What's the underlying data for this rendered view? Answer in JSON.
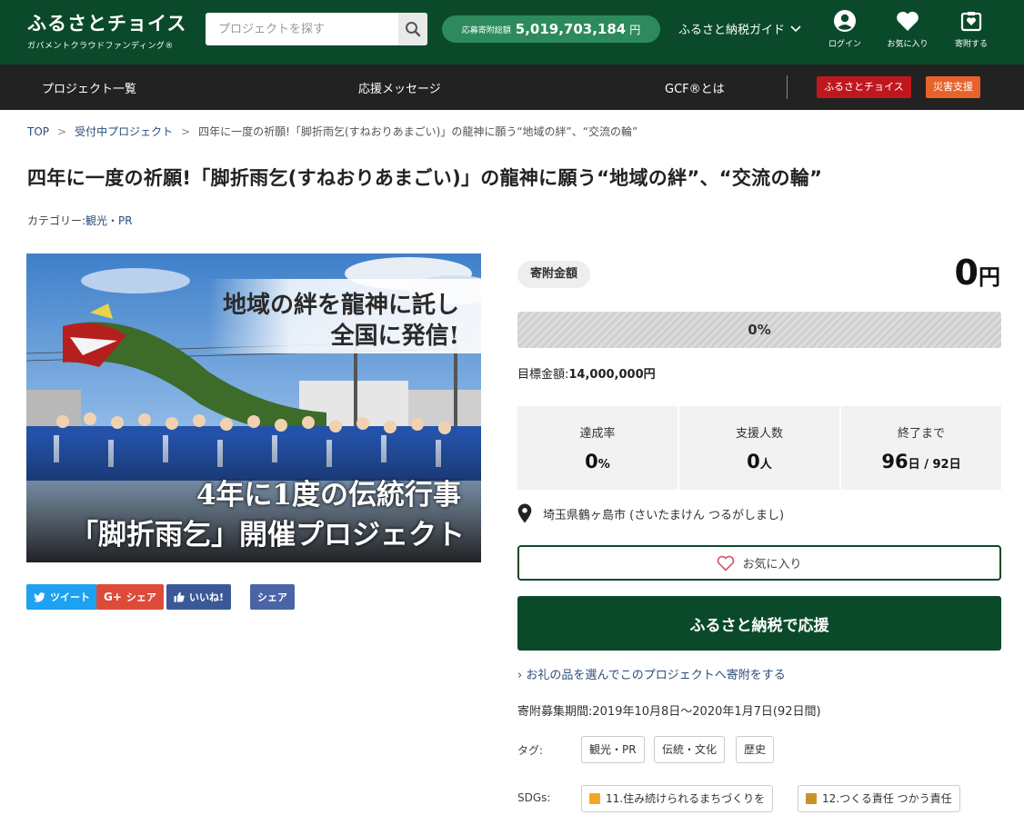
{
  "header": {
    "logo_main": "ふるさとチョイス",
    "logo_sub": "ガバメントクラウドファンディング®",
    "search_placeholder": "プロジェクトを探す",
    "total_label": "応募寄附総額",
    "total_value": "5,019,703,184",
    "total_unit": "円",
    "guide_label": "ふるさと納税ガイド",
    "login_label": "ログイン",
    "favorites_label": "お気に入り",
    "donate_label": "寄附する"
  },
  "nav": {
    "items": [
      "プロジェクト一覧",
      "応援メッセージ",
      "GCF®とは"
    ],
    "badge_choice": "ふるさとチョイス",
    "badge_disaster": "災害支援"
  },
  "breadcrumb": [
    "TOP",
    "受付中プロジェクト",
    "四年に一度の祈願!「脚折雨乞(すねおりあまごい)」の龍神に願う“地域の絆”、“交流の輪”"
  ],
  "page": {
    "title": "四年に一度の祈願!「脚折雨乞(すねおりあまごい)」の龍神に願う“地域の絆”、“交流の輪”",
    "category_label": "カテゴリー:",
    "category_value": "観光・PR"
  },
  "hero": {
    "line1": "地域の絆を龍神に託し",
    "line2": "全国に発信!",
    "line3": "4年に1度の伝統行事",
    "line4": "「脚折雨乞」開催プロジェクト"
  },
  "share": {
    "tweet": "ツイート",
    "gplus": "シェア",
    "like": "いいね!",
    "fb_share": "シェア"
  },
  "funding": {
    "amount_label": "寄附金額",
    "amount_value": "0",
    "amount_unit": "円",
    "progress_percent": 0,
    "progress_text": "0%",
    "goal_label": "目標金額:",
    "goal_value": "14,000,000円",
    "stats": {
      "rate_label": "達成率",
      "rate_value": "0",
      "rate_unit": "%",
      "supporters_label": "支援人数",
      "supporters_value": "0",
      "supporters_unit": "人",
      "remaining_label": "終了まで",
      "remaining_value": "96",
      "remaining_unit": "日",
      "remaining_total": " / 92日"
    },
    "location": "埼玉県鶴ヶ島市 (さいたまけん つるがしまし)",
    "favorite_button": "お気に入り",
    "support_button": "ふるさと納税で応援",
    "gift_link": "お礼の品を選んでこのプロジェクトへ寄附をする",
    "period": "寄附募集期間:2019年10月8日〜2020年1月7日(92日間)",
    "tags_label": "タグ:",
    "tags": [
      "観光・PR",
      "伝統・文化",
      "歴史"
    ],
    "sdgs_label": "SDGs:",
    "sdgs": [
      "11.住み続けられるまちづくりを",
      "12.つくる責任 つかう責任"
    ]
  },
  "colors": {
    "header_green": "#0a4a2a",
    "nav_dark": "#222222",
    "pill_green": "#2d8a5c",
    "badge_red": "#c0171e",
    "badge_orange": "#e8622a",
    "twitter": "#1da1f2",
    "gplus": "#dd4b39",
    "facebook": "#3b5998",
    "link_blue": "#2a4d7a"
  }
}
